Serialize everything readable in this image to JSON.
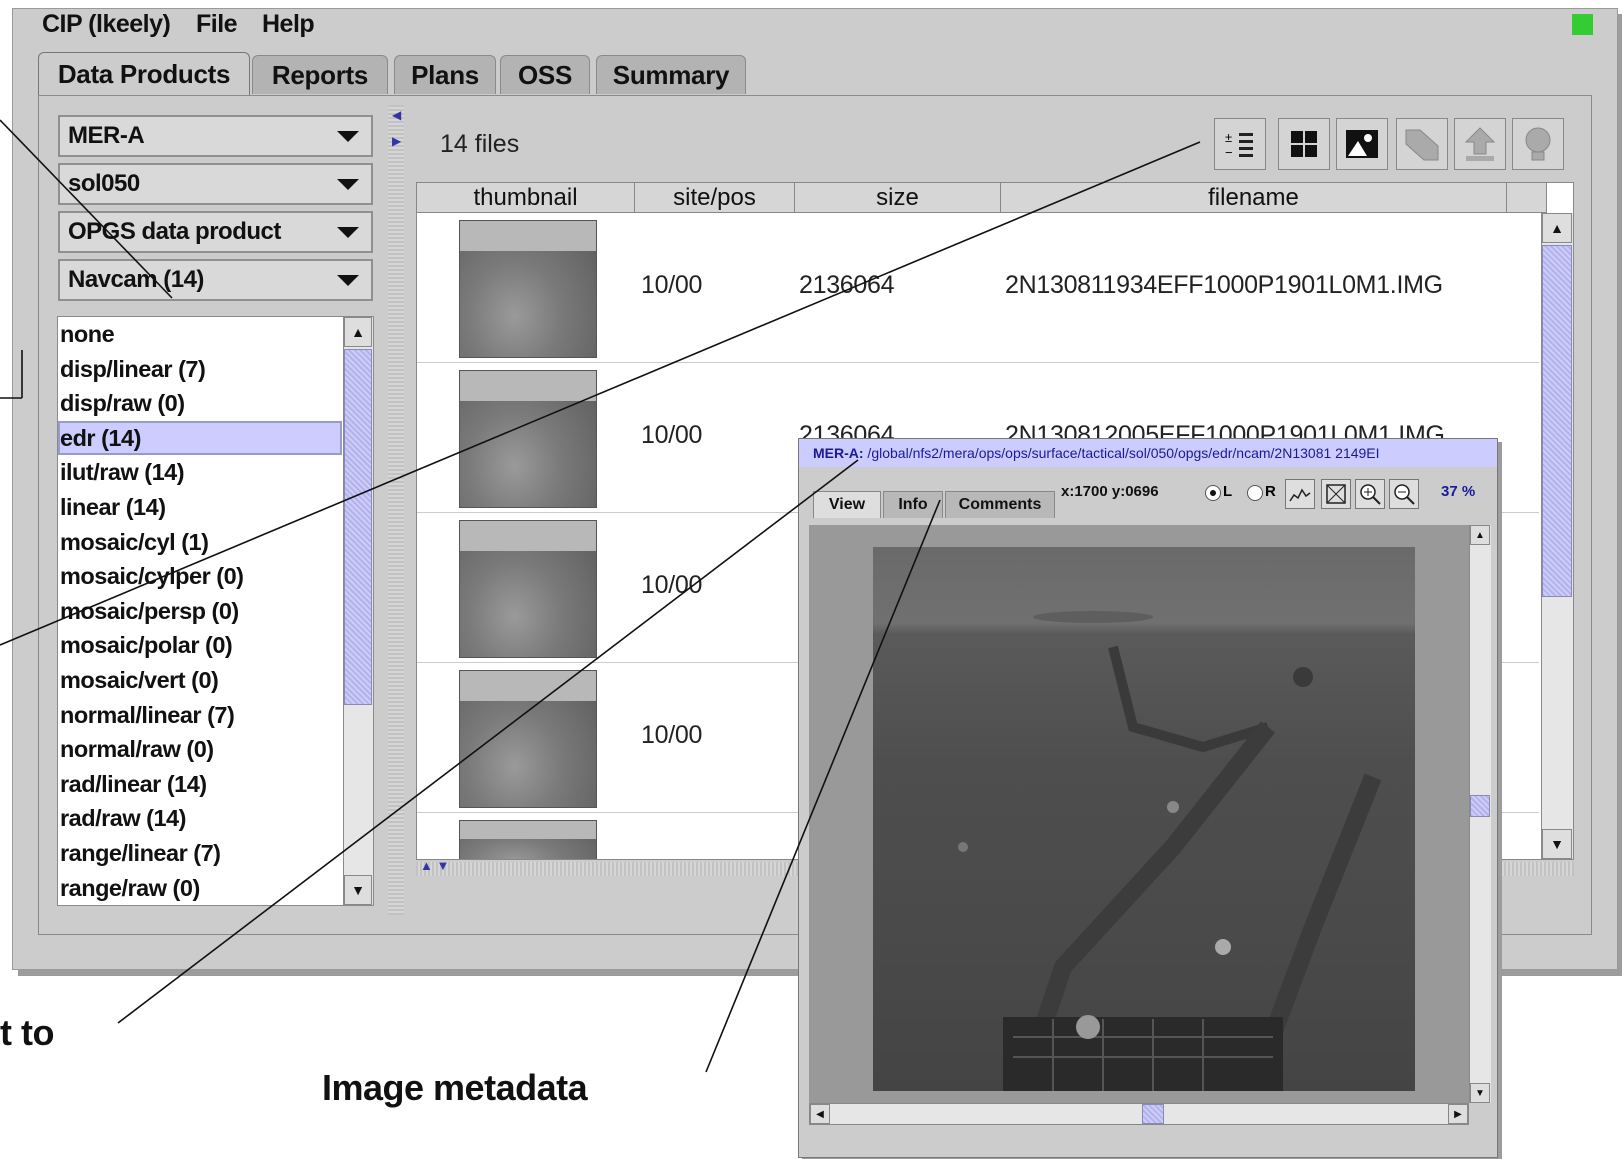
{
  "menu": {
    "app": "CIP (lkeely)",
    "file": "File",
    "help": "Help"
  },
  "tabs": [
    "Data Products",
    "Reports",
    "Plans",
    "OSS",
    "Summary"
  ],
  "filters": {
    "mission": "MER-A",
    "sol": "sol050",
    "product_type": "OPGS data product",
    "instrument": "Navcam (14)"
  },
  "product_list": [
    "none",
    "disp/linear (7)",
    "disp/raw (0)",
    "edr (14)",
    "ilut/raw (14)",
    "linear (14)",
    "mosaic/cyl (1)",
    "mosaic/cylper (0)",
    "mosaic/persp (0)",
    "mosaic/polar (0)",
    "mosaic/vert (0)",
    "normal/linear (7)",
    "normal/raw (0)",
    "rad/linear (14)",
    "rad/raw (14)",
    "range/linear (7)",
    "range/raw (0)"
  ],
  "selected_product": "edr (14)",
  "file_count": "14 files",
  "toolbar_icons": [
    "sort-list-icon",
    "grid-view-icon",
    "image-view-icon",
    "mosaic-icon",
    "upload-icon",
    "lightbulb-icon"
  ],
  "table": {
    "columns": [
      "thumbnail",
      "site/pos",
      "size",
      "filename"
    ],
    "rows": [
      {
        "site_pos": "10/00",
        "size": "2136064",
        "filename": "2N130811934EFF1000P1901L0M1.IMG"
      },
      {
        "site_pos": "10/00",
        "size": "2136064",
        "filename": "2N130812005EFF1000P1901L0M1.IMG"
      },
      {
        "site_pos": "10/00",
        "size": "",
        "filename": ""
      },
      {
        "site_pos": "10/00",
        "size": "",
        "filename": ""
      }
    ]
  },
  "viewer": {
    "path_label": "MER-A:",
    "path": " /global/nfs2/mera/ops/ops/surface/tactical/sol/050/opgs/edr/ncam/2N13081 2149EI",
    "tabs": [
      "View",
      "Info",
      "Comments"
    ],
    "coords": "x:1700 y:0696",
    "eye_left": "L",
    "eye_right": "R",
    "zoom": "37 %"
  },
  "callouts": {
    "left_fragment": "t to",
    "image_metadata": "Image metadata"
  }
}
